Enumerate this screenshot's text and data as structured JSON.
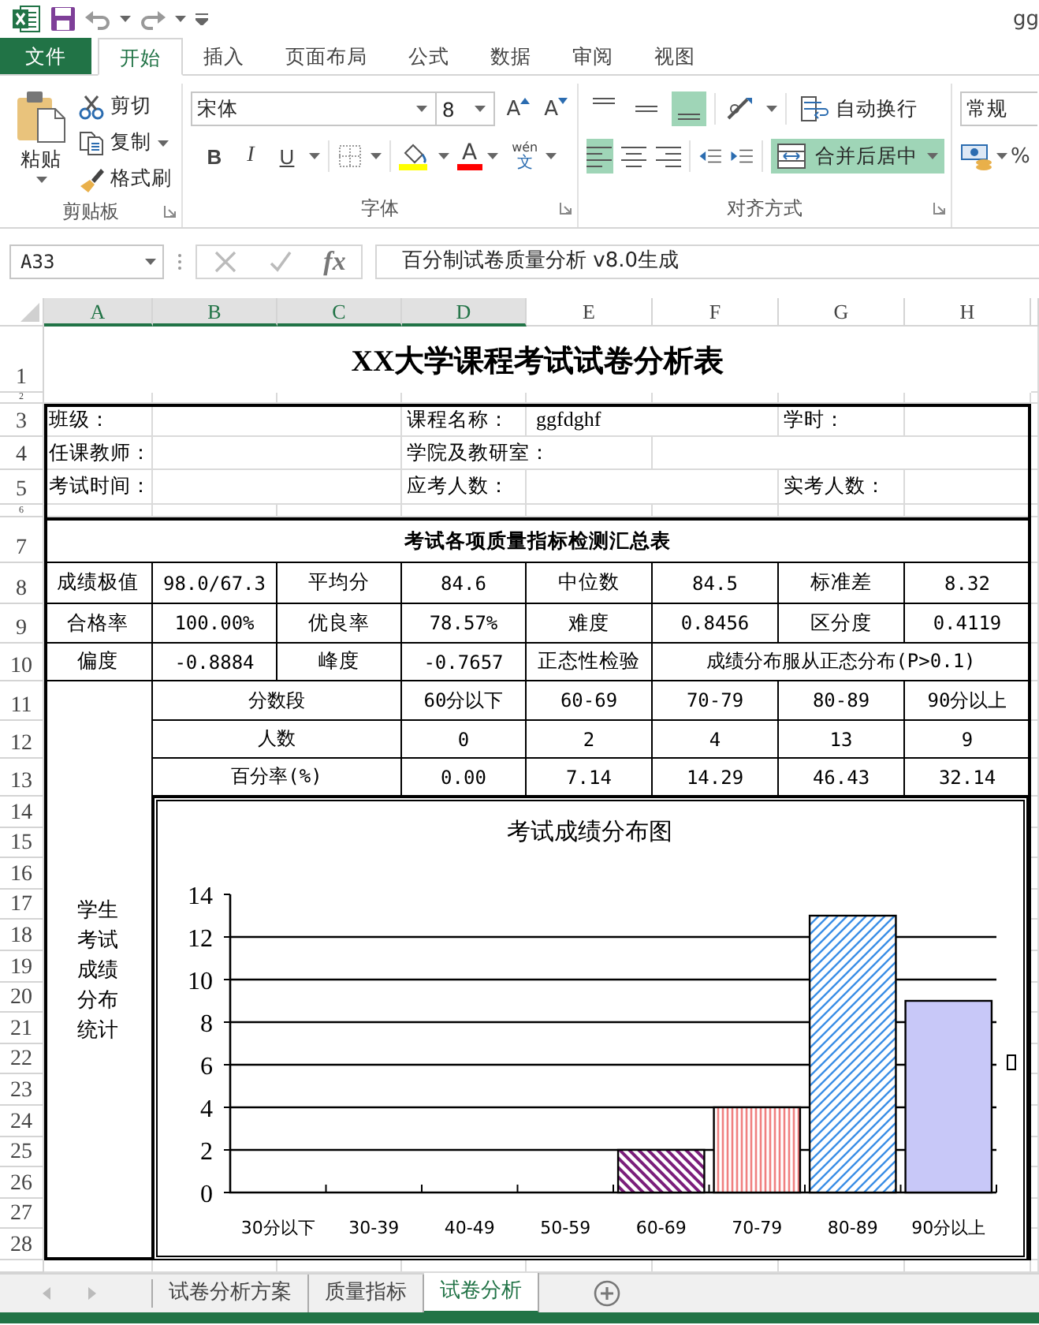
{
  "window": {
    "title": "gg"
  },
  "ribbon_tabs": [
    {
      "label": "文件",
      "kind": "file",
      "selected": false
    },
    {
      "label": "开始",
      "kind": "tab",
      "selected": true
    },
    {
      "label": "插入",
      "kind": "tab",
      "selected": false
    },
    {
      "label": "页面布局",
      "kind": "tab",
      "selected": false
    },
    {
      "label": "公式",
      "kind": "tab",
      "selected": false
    },
    {
      "label": "数据",
      "kind": "tab",
      "selected": false
    },
    {
      "label": "审阅",
      "kind": "tab",
      "selected": false
    },
    {
      "label": "视图",
      "kind": "tab",
      "selected": false
    }
  ],
  "ribbon": {
    "clipboard": {
      "label": "剪贴板",
      "paste": "粘贴",
      "cut": "剪切",
      "copy": "复制",
      "format_painter": "格式刷"
    },
    "font": {
      "label": "字体",
      "name": "宋体",
      "size": "8",
      "grow": "A",
      "shrink": "A",
      "bold": "B",
      "italic": "I",
      "underline": "U",
      "color_button": "A",
      "phonetic": "wén",
      "phonetic_char": "文"
    },
    "alignment": {
      "label": "对齐方式",
      "vertical": [
        {
          "selected": false
        },
        {
          "selected": false
        },
        {
          "selected": true
        }
      ],
      "horizontal": [
        {
          "selected": true
        },
        {
          "selected": false
        },
        {
          "selected": false
        }
      ],
      "wrap": "自动换行",
      "merge": {
        "label": "合并后居中",
        "on": true
      }
    },
    "number": {
      "format": "常规",
      "percent": "%"
    }
  },
  "formula_bar": {
    "name_box": "A33",
    "function_label": "fx",
    "formula": "百分制试卷质量分析 v8.0生成"
  },
  "columns": [
    {
      "label": "A",
      "selected": true
    },
    {
      "label": "B",
      "selected": true
    },
    {
      "label": "C",
      "selected": true
    },
    {
      "label": "D",
      "selected": true
    },
    {
      "label": "E",
      "selected": false
    },
    {
      "label": "F",
      "selected": false
    },
    {
      "label": "G",
      "selected": false
    },
    {
      "label": "H",
      "selected": false
    }
  ],
  "row_numbers": [
    "1",
    "2",
    "3",
    "4",
    "5",
    "6",
    "7",
    "8",
    "9",
    "10",
    "11",
    "12",
    "13",
    "14",
    "15",
    "16",
    "17",
    "18",
    "19",
    "20",
    "21",
    "22",
    "23",
    "24",
    "25",
    "26",
    "27",
    "28"
  ],
  "sheet": {
    "title": "XX大学课程考试试卷分析表",
    "info": [
      [
        {
          "label": "班级："
        },
        {
          "label": "课程名称：",
          "value": "ggfdghf"
        },
        {
          "label": "学时："
        }
      ],
      [
        {
          "label": "任课教师："
        },
        {
          "label": "学院及教研室："
        }
      ],
      [
        {
          "label": "考试时间："
        },
        {
          "label": "应考人数："
        },
        {
          "label": "实考人数："
        }
      ]
    ],
    "summary": {
      "title": "考试各项质量指标检测汇总表",
      "rows": [
        [
          "成绩极值",
          "98.0/67.3",
          "平均分",
          "84.6",
          "中位数",
          "84.5",
          "标准差",
          "8.32"
        ],
        [
          "合格率",
          "100.00%",
          "优良率",
          "78.57%",
          "难度",
          "0.8456",
          "区分度",
          "0.4119"
        ],
        [
          "偏度",
          "-0.8884",
          "峰度",
          "-0.7657",
          "正态性检验",
          "成绩分布服从正态分布(P>0.1)"
        ]
      ]
    },
    "distribution": {
      "label": "学生考试成绩分布统计",
      "rows": [
        [
          "分数段",
          "60分以下",
          "60-69",
          "70-79",
          "80-89",
          "90分以上"
        ],
        [
          "人数",
          "0",
          "2",
          "4",
          "13",
          "9"
        ],
        [
          "百分率(%)",
          "0.00",
          "7.14",
          "14.29",
          "46.43",
          "32.14"
        ]
      ],
      "chart_data": {
        "type": "bar",
        "title": "考试成绩分布图",
        "categories": [
          "30分以下",
          "30-39",
          "40-49",
          "50-59",
          "60-69",
          "70-79",
          "80-89",
          "90分以上"
        ],
        "series": [
          {
            "values": [
              0,
              0,
              0,
              0,
              2,
              4,
              13,
              9
            ]
          }
        ],
        "grid": true,
        "ylim": [
          0,
          14
        ],
        "yticks": [
          0,
          2,
          4,
          6,
          8,
          10,
          12,
          14
        ]
      }
    }
  },
  "sheet_tabs": [
    {
      "label": "试卷分析方案",
      "selected": false
    },
    {
      "label": "质量指标",
      "selected": false
    },
    {
      "label": "试卷分析",
      "selected": true
    }
  ]
}
